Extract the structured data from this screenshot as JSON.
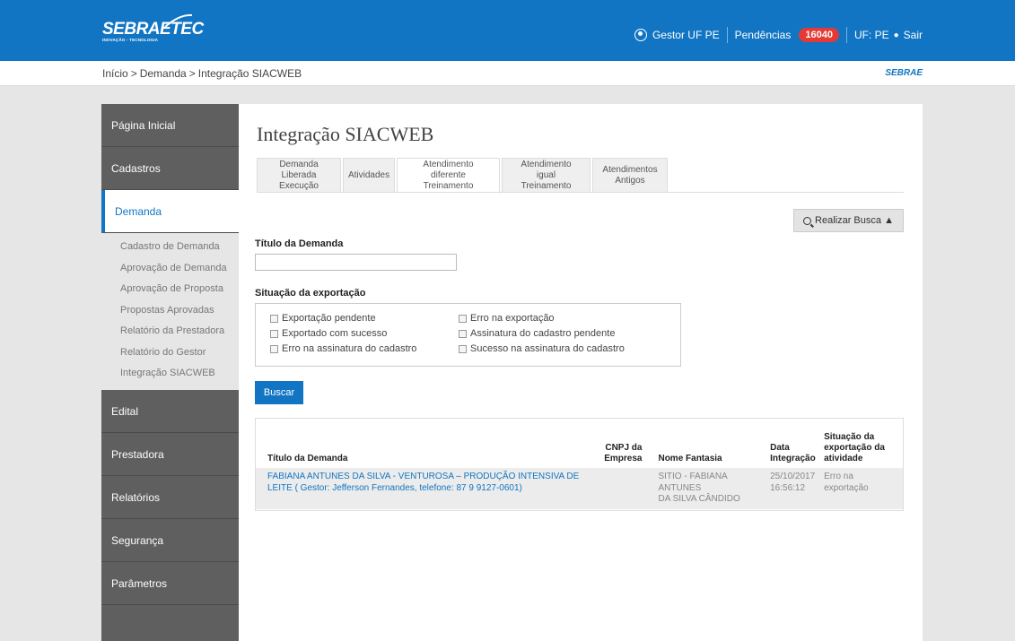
{
  "header": {
    "logo_main": "SEBRAETEC",
    "logo_sub": "INOVAÇÃO - TECNOLOGIA",
    "user": "Gestor UF PE",
    "pendencias_label": "Pendências",
    "pendencias_count": "16040",
    "uf_label": "UF: PE",
    "logout_label": "Sair"
  },
  "breadcrumb": {
    "items": [
      "Início",
      "Demanda",
      "Integração SIACWEB"
    ],
    "brand": "SEBRAE"
  },
  "sidebar": {
    "items": [
      "Página Inicial",
      "Cadastros",
      "Demanda",
      "Edital",
      "Prestadora",
      "Relatórios",
      "Segurança",
      "Parâmetros"
    ],
    "submenu": [
      "Cadastro de Demanda",
      "Aprovação de Demanda",
      "Aprovação de Proposta",
      "Propostas Aprovadas",
      "Relatório da Prestadora",
      "Relatório do Gestor",
      "Integração SIACWEB"
    ]
  },
  "main": {
    "title": "Integração SIACWEB",
    "tabs": [
      {
        "line1": "Demanda Liberada",
        "line2": "Execução"
      },
      {
        "line1": "Atividades",
        "line2": ""
      },
      {
        "line1": "Atendimento diferente",
        "line2": "Treinamento"
      },
      {
        "line1": "Atendimento igual",
        "line2": "Treinamento"
      },
      {
        "line1": "Atendimentos",
        "line2": "Antigos"
      }
    ],
    "search_toggle": "Realizar Busca ▲",
    "titulo_label": "Título da Demanda",
    "situacao_label": "Situação da exportação",
    "checkboxes": [
      "Exportação pendente",
      "Erro na exportação",
      "Exportado com sucesso",
      "Assinatura do cadastro pendente",
      "Erro na assinatura do cadastro",
      "Sucesso na assinatura do cadastro"
    ],
    "buscar": "Buscar"
  },
  "results": {
    "headers": {
      "titulo": "Título da Demanda",
      "cnpj1": "CNPJ da",
      "cnpj2": "Empresa",
      "fantasia": "Nome Fantasia",
      "data1": "Data",
      "data2": "Integração",
      "sit1": "Situação da",
      "sit2": "exportação da",
      "sit3": "atividade"
    },
    "row": {
      "titulo1": "FABIANA ANTUNES DA SILVA - VENTUROSA – PRODUÇÃO INTENSIVA DE",
      "titulo2": "LEITE ( Gestor: Jefferson Fernandes, telefone: 87 9 9127-0601)",
      "cnpj": "",
      "fantasia1": "SITIO - FABIANA ANTUNES",
      "fantasia2": "DA SILVA CÂNDIDO",
      "data1": "25/10/2017",
      "data2": "16:56:12",
      "sit1": "Erro na",
      "sit2": "exportação"
    }
  }
}
